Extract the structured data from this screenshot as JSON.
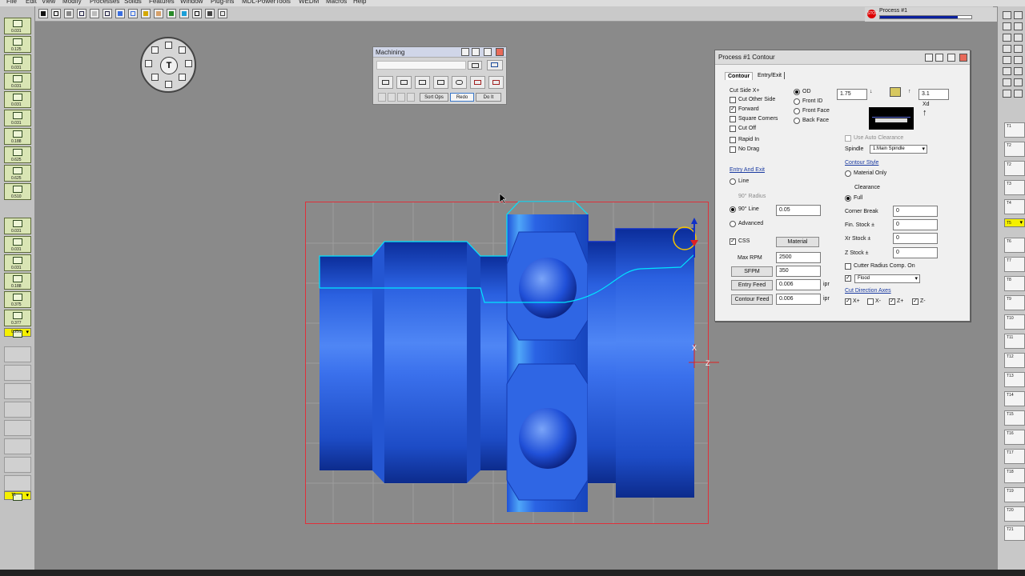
{
  "menu": [
    "File",
    "Edit",
    "View",
    "Modify",
    "Processes",
    "Solids",
    "Features",
    "Window",
    "Plug-Ins",
    "MDL-PowerTools",
    "WEDM",
    "Macros",
    "Help"
  ],
  "status": {
    "process_label": "Process #1",
    "stop_label": "STOP",
    "progress": 0.85
  },
  "left_tools": [
    "0.031",
    "0.125",
    "0.031",
    "0.031",
    "0.031",
    "0.031",
    "0.188",
    "0.625",
    "0.625",
    "0.510",
    "0.031",
    "0.031",
    "0.031",
    "0.188",
    "0.375",
    "0.377",
    "0.251",
    "T1"
  ],
  "right_slots": [
    "T1",
    "T2",
    "T2",
    "T3",
    "T4",
    "T5",
    "T6",
    "T7",
    "T8",
    "T9",
    "T10",
    "T11",
    "T12",
    "T13",
    "T14",
    "T15",
    "T16",
    "T17",
    "T18",
    "T19",
    "T20",
    "T21"
  ],
  "dial": {
    "center_label": "T"
  },
  "machining": {
    "title": "Machining",
    "sort_ops": "Sort Ops",
    "redo": "Redo",
    "do_it": "Do It"
  },
  "dialog": {
    "title": "Process #1 Contour",
    "tab_contour": "Contour",
    "tab_entry_exit": "Entry/Exit",
    "cut_side": "Cut Side X+",
    "cut_other_side": "Cut Other Side",
    "forward": "Forward",
    "square_corners": "Square Corners",
    "cut_off": "Cut Off",
    "rapid_in": "Rapid In",
    "no_drag": "No Drag",
    "od": "OD",
    "front_id": "Front ID",
    "front_face": "Front Face",
    "back_face": "Back Face",
    "top_value_1": "1.75",
    "top_value_2": "3.1",
    "xd_label": "Xd",
    "use_auto_clearance": "Use Auto Clearance",
    "spindle_label": "Spindle",
    "spindle_value": "1:Main Spindle",
    "contour_style": "Contour Style",
    "material_only": "Material Only",
    "clearance": "Clearance",
    "full": "Full",
    "entry_and_exit": "Entry And Exit",
    "line": "Line",
    "radius_90": "90° Radius",
    "line_90": "90° Line",
    "line_90_value": "0.05",
    "advanced": "Advanced",
    "css": "CSS",
    "material_btn": "Material",
    "max_rpm_label": "Max RPM",
    "max_rpm_value": "2500",
    "sfpm_btn": "SFPM",
    "sfpm_value": "350",
    "entry_feed_btn": "Entry Feed",
    "entry_feed_value": "0.006",
    "contour_feed_btn": "Contour Feed",
    "contour_feed_value": "0.006",
    "ipr_1": "ipr",
    "ipr_2": "ipr",
    "corner_break_label": "Corner Break",
    "corner_break_value": "0",
    "fin_stock_label": "Fin. Stock ±",
    "fin_stock_value": "0",
    "xr_stock_label": "Xr Stock ±",
    "xr_stock_value": "0",
    "z_stock_label": "Z Stock ±",
    "z_stock_value": "0",
    "cutter_radius_comp": "Cutter Radius Comp. On",
    "coolant_value": "Flood",
    "cut_direction_axes": "Cut Direction Axes",
    "axis_x_plus": "X+",
    "axis_x_minus": "X-",
    "axis_z_plus": "Z+",
    "axis_z_minus": "Z-"
  },
  "viewport": {
    "z_axis": "Z",
    "x_axis": "X"
  },
  "colors": {
    "part_blue": "#2a5fd8",
    "toolpath": "#00e5ff",
    "boundary": "#e0303a",
    "highlight": "#f5f000"
  }
}
